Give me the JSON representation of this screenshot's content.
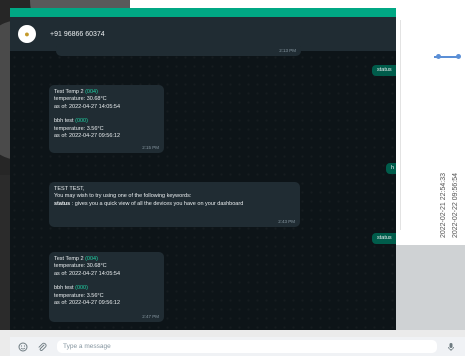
{
  "chat": {
    "contact_name": "+91 96866 60374",
    "messages": [
      {
        "direction": "in",
        "time": "2:13 PM"
      },
      {
        "direction": "out",
        "text": "status"
      },
      {
        "direction": "in",
        "time": "2:15 PM",
        "device1": {
          "name": "Test Temp 2",
          "id": "(004)",
          "reading": "temperature: 30.68°C",
          "as_of": "as of: 2022-04-27 14:05:54"
        },
        "device2": {
          "name": "bbh test",
          "id": "(000)",
          "reading": "temperature: 3.56°C",
          "as_of": "as of: 2022-04-27 09:56:12"
        }
      },
      {
        "direction": "out",
        "text": "h"
      },
      {
        "direction": "in",
        "time": "2:43 PM",
        "greeting": "TEST TEST,",
        "intro": "You may wish to try using one of the following keywords:",
        "keyword": "status",
        "keyword_desc": ": gives you a quick view of all the devices you have on your dashboard"
      },
      {
        "direction": "out",
        "text": "status"
      },
      {
        "direction": "in",
        "time": "2:47 PM",
        "device1": {
          "name": "Test Temp 2",
          "id": "(004)",
          "reading": "temperature: 30.68°C",
          "as_of": "as of: 2022-04-27 14:05:54"
        },
        "device2": {
          "name": "bbh test",
          "id": "(000)",
          "reading": "temperature: 3.56°C",
          "as_of": "as of: 2022-04-27 09:56:12"
        }
      }
    ]
  },
  "composer": {
    "placeholder": "Type a message"
  },
  "background_chart": {
    "date_labels": [
      "2022-02-21 22:54:33",
      "2022-02-22 09:56:54"
    ]
  },
  "colors": {
    "header_green": "#00a884",
    "incoming": "#202c33",
    "outgoing": "#005c4b",
    "highlight": "#1fd1a3"
  },
  "icons": [
    "user-avatar-icon",
    "emoji-icon",
    "attach-icon",
    "mic-icon"
  ]
}
